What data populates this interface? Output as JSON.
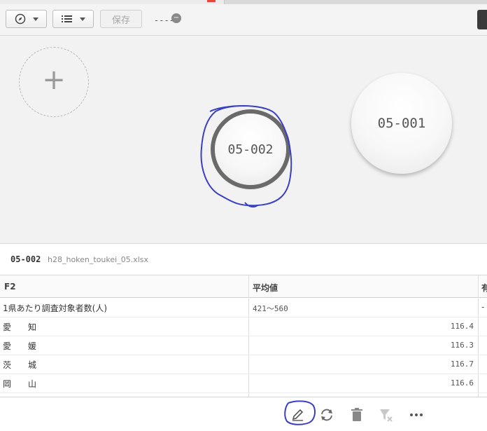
{
  "toolbar": {
    "compass_icon": "compass-icon",
    "list_icon": "list-icon",
    "save_label": "保存",
    "bookmark_label": "-----",
    "bookmark_badge": "−"
  },
  "canvas": {
    "add_symbol": "+",
    "bubbles": [
      {
        "label": "05-002",
        "selected": true
      },
      {
        "label": "05-001",
        "selected": false
      }
    ]
  },
  "info": {
    "code": "05-002",
    "file": "h28_hoken_toukei_05.xlsx"
  },
  "table": {
    "headers": [
      "F2",
      "平均値",
      "有"
    ],
    "rows": [
      [
        "1県あたり調査対象者数(人)",
        "421～560",
        "-"
      ],
      [
        "愛　　知",
        "116.4",
        ""
      ],
      [
        "愛　　媛",
        "116.3",
        ""
      ],
      [
        "茨　　城",
        "116.7",
        ""
      ],
      [
        "岡　　山",
        "116.6",
        ""
      ]
    ]
  },
  "footer": {
    "icons": [
      "pencil-icon",
      "refresh-icon",
      "trash-icon",
      "filter-clear-icon",
      "more-icon"
    ]
  },
  "colors": {
    "annotation": "#3a3fc4",
    "selected_ring": "#6a6a6a"
  }
}
